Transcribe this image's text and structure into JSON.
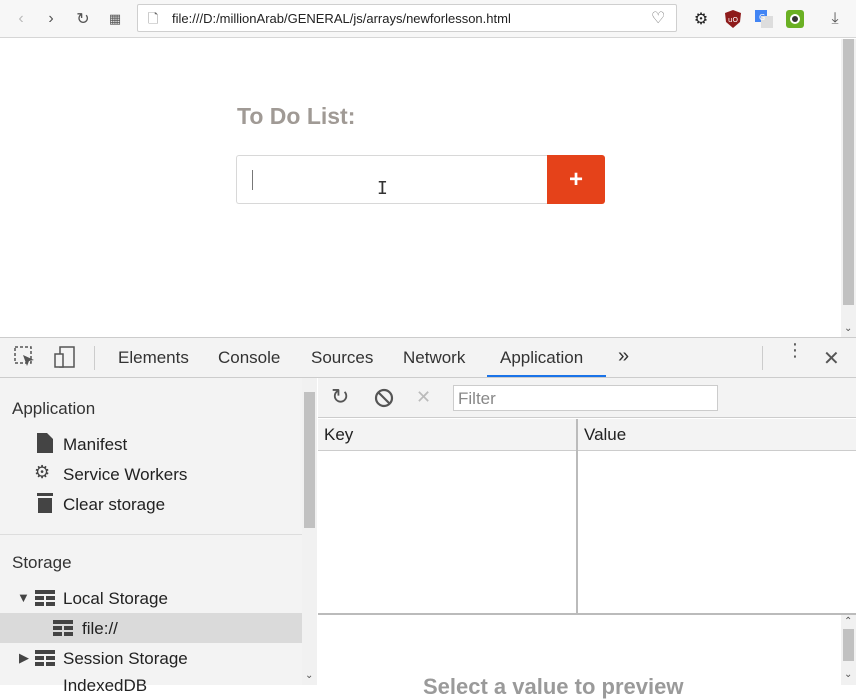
{
  "browser": {
    "url": "file:///D:/millionArab/GENERAL/js/arrays/newforlesson.html"
  },
  "page": {
    "title": "To Do List:",
    "add_button_label": "+"
  },
  "devtools": {
    "tabs": [
      "Elements",
      "Console",
      "Sources",
      "Network",
      "Application"
    ],
    "active_tab": "Application",
    "more_tabs_label": "»",
    "sidebar": {
      "application_section": "Application",
      "application_items": [
        "Manifest",
        "Service Workers",
        "Clear storage"
      ],
      "storage_section": "Storage",
      "local_storage": "Local Storage",
      "local_storage_child": "file://",
      "session_storage": "Session Storage",
      "indexeddb": "IndexedDB"
    },
    "main": {
      "filter_placeholder": "Filter",
      "columns": [
        "Key",
        "Value"
      ],
      "preview_text": "Select a value to preview"
    }
  },
  "colors": {
    "accent": "#e5421a",
    "active_tab": "#1a73e8"
  }
}
